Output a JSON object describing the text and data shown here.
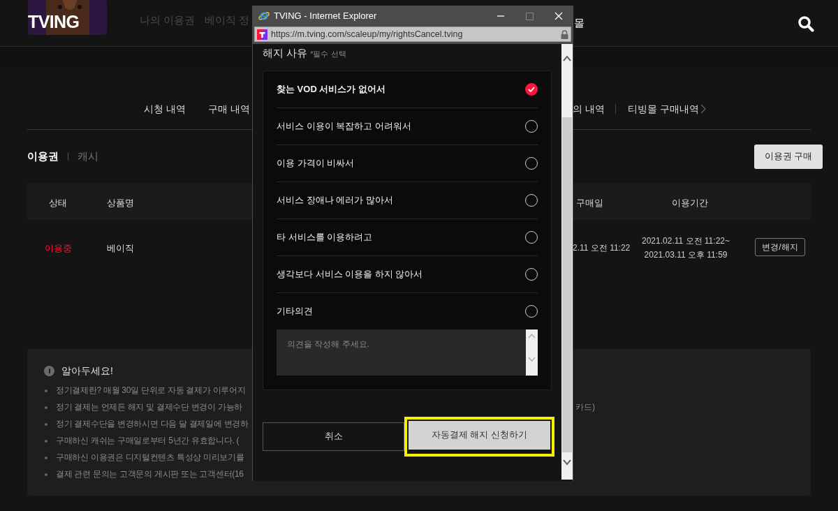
{
  "header": {
    "logo": "TVING",
    "nav": [
      {
        "label": "나의 이용권"
      },
      {
        "label": "베이직 정"
      },
      {
        "label": "몰"
      }
    ]
  },
  "subnav": [
    {
      "label": "시청 내역"
    },
    {
      "label": "구매 내역"
    },
    {
      "label": "의 내역"
    },
    {
      "label": "티빙몰 구매내역"
    }
  ],
  "tabs": [
    {
      "label": "이용권",
      "selected": true
    },
    {
      "label": "캐시",
      "selected": false
    }
  ],
  "purchase_button": "이용권 구매",
  "table": {
    "columns": [
      "상태",
      "상품명",
      "구매일",
      "이용기간"
    ],
    "rows": [
      {
        "status": "이용중",
        "active": true,
        "product": "베이직",
        "purchase_date": "2.11 오전 11:22",
        "period": [
          "2021.02.11 오전 11:22~",
          "2021.03.11 오후 11:59"
        ],
        "action": "변경/해지"
      }
    ]
  },
  "notice": {
    "title": "알아두세요!",
    "items": [
      {
        "text": "정기결제란? 매월 30일 단위로 자동 결제가 이루어지"
      },
      {
        "text": "정기 결제는 언제든 해지 및 결제수단 변경이 가능하",
        "tail": "카드)"
      },
      {
        "text": "정기 결제수단을 변경하시면 다음 달 결제일에 변경하"
      },
      {
        "text": "구매하신 캐쉬는 구매일로부터 5년간 유효합니다. ("
      },
      {
        "text": "구매하신 이용권은 디지털컨텐츠 특성상 미리보기를"
      },
      {
        "text": "결제 관련 문의는 고객문의 게시판 또는 고객센터(16"
      }
    ]
  },
  "popup": {
    "title": "TVING - Internet Explorer",
    "url": "https://m.tving.com/scaleup/my/rightsCancel.tving",
    "heading": "해지 사유",
    "required_note": "*필수 선택",
    "reasons": [
      {
        "label": "찾는 VOD 서비스가 없어서",
        "selected": true
      },
      {
        "label": "서비스 이용이 복잡하고 어려워서",
        "selected": false
      },
      {
        "label": "이용 가격이 비싸서",
        "selected": false
      },
      {
        "label": "서비스 장애나 에러가 많아서",
        "selected": false
      },
      {
        "label": "타 서비스를 이용하려고",
        "selected": false
      },
      {
        "label": "생각보다 서비스 이용을 하지 않아서",
        "selected": false
      },
      {
        "label": "기타의견",
        "selected": false
      }
    ],
    "comment_placeholder": "의견을 작성해 주세요.",
    "buttons": [
      {
        "label": "취소",
        "kind": "secondary",
        "highlighted": false
      },
      {
        "label": "자동결제 해지 신청하기",
        "kind": "primary",
        "highlighted": true
      }
    ]
  }
}
